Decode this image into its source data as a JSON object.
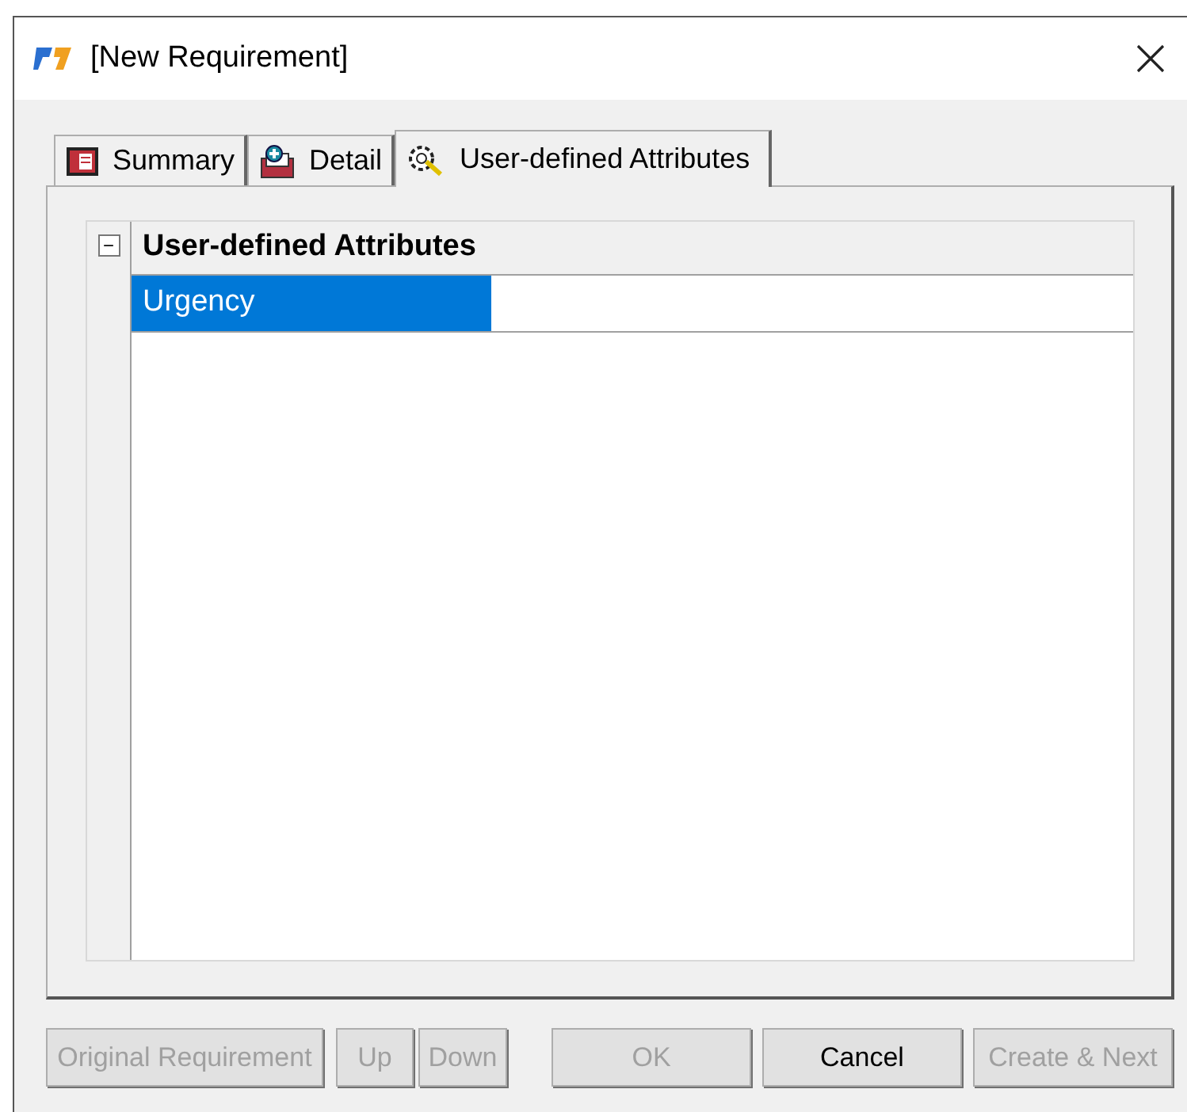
{
  "window": {
    "title": "[New Requirement]"
  },
  "tabs": [
    {
      "label": "Summary",
      "selected": false
    },
    {
      "label": "Detail",
      "selected": false
    },
    {
      "label": "User-defined Attributes",
      "selected": true
    }
  ],
  "grid": {
    "category": {
      "label": "User-defined Attributes",
      "expanded": true,
      "toggle": "−"
    },
    "rows": [
      {
        "name": "Urgency",
        "selected": true
      }
    ]
  },
  "buttons_left": [
    {
      "label": "Original Requirement",
      "disabled": true
    },
    {
      "label": "Up",
      "disabled": true
    },
    {
      "label": "Down",
      "disabled": true
    }
  ],
  "buttons_right": [
    {
      "label": "OK",
      "disabled": true
    },
    {
      "label": "Cancel",
      "disabled": false
    },
    {
      "label": "Create & Next",
      "disabled": true
    }
  ]
}
